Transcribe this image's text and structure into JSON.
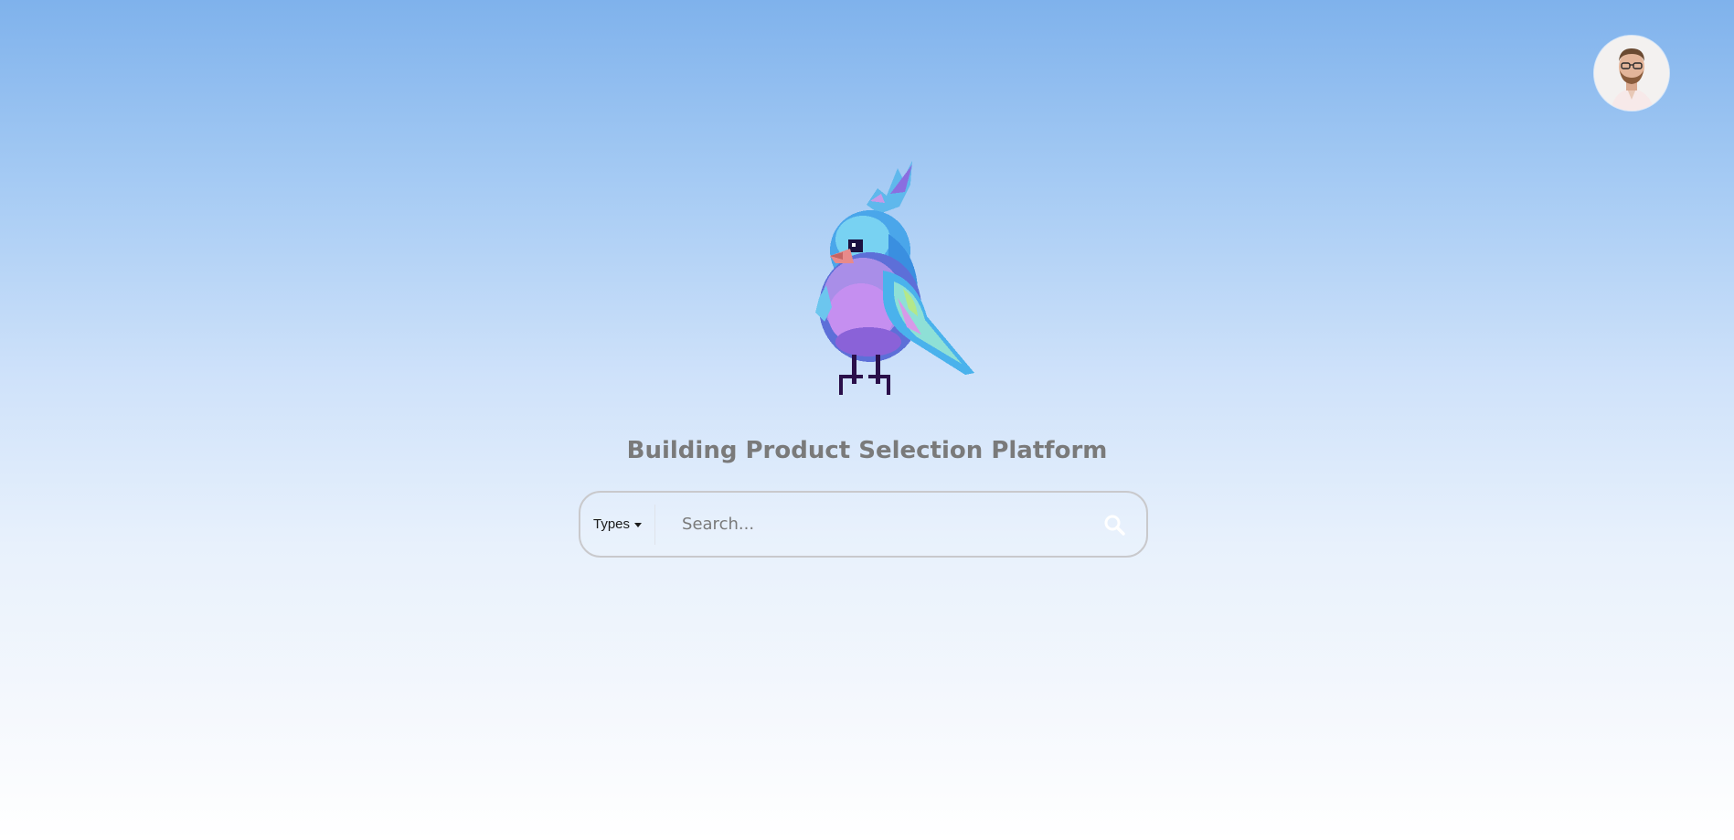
{
  "header": {
    "avatar_icon": "user-avatar-photo"
  },
  "hero": {
    "mascot_icon": "pixel-bird-logo",
    "title": "Building Product Selection Platform"
  },
  "search": {
    "types_label": "Types",
    "placeholder": "Search...",
    "value": "",
    "search_icon": "search-icon"
  },
  "colors": {
    "background_top": "#7fb2ec",
    "background_bottom": "#ffffff",
    "title": "#7a7a7a",
    "search_border": "#c9c9cc"
  }
}
